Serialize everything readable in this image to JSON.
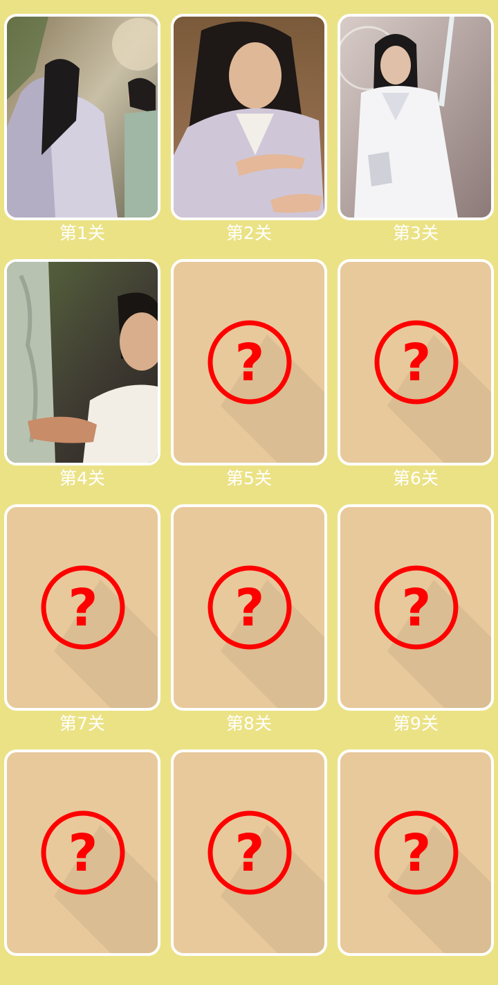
{
  "theme": {
    "background": "#ebe286",
    "locked_card": "#e8c99c",
    "lock_color": "#ff0000",
    "caption_color": "#ffffff"
  },
  "levels": [
    {
      "label": "第1关",
      "unlocked": true
    },
    {
      "label": "第2关",
      "unlocked": true
    },
    {
      "label": "第3关",
      "unlocked": true
    },
    {
      "label": "第4关",
      "unlocked": true
    },
    {
      "label": "第5关",
      "unlocked": false,
      "icon": "question-mark-icon"
    },
    {
      "label": "第6关",
      "unlocked": false,
      "icon": "question-mark-icon"
    },
    {
      "label": "第7关",
      "unlocked": false,
      "icon": "question-mark-icon"
    },
    {
      "label": "第8关",
      "unlocked": false,
      "icon": "question-mark-icon"
    },
    {
      "label": "第9关",
      "unlocked": false,
      "icon": "question-mark-icon"
    },
    {
      "label": "",
      "unlocked": false,
      "icon": "question-mark-icon"
    },
    {
      "label": "",
      "unlocked": false,
      "icon": "question-mark-icon"
    },
    {
      "label": "",
      "unlocked": false,
      "icon": "question-mark-icon"
    }
  ]
}
